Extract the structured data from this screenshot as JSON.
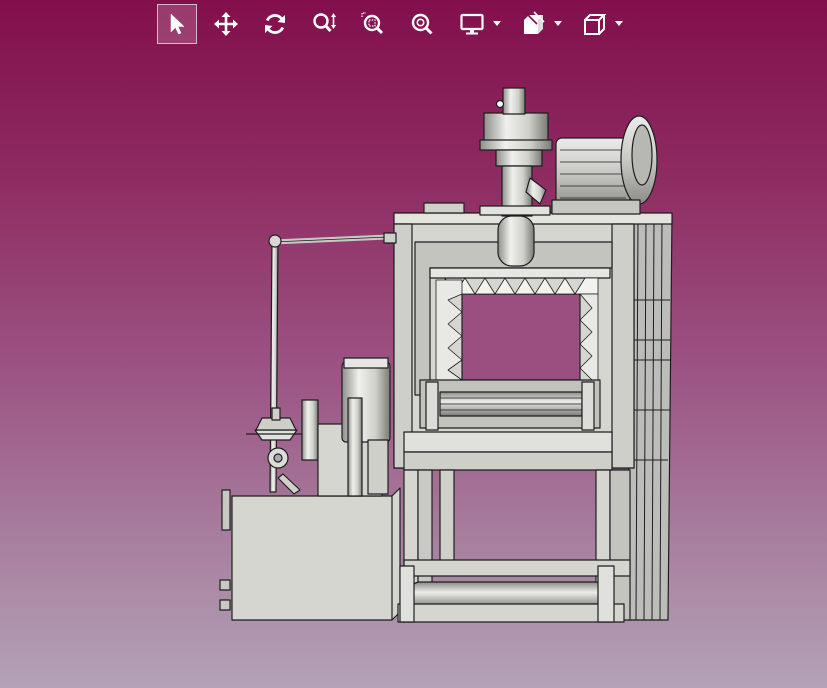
{
  "toolbar": {
    "tools": [
      {
        "name": "select",
        "icon": "arrow-cursor-icon",
        "active": true
      },
      {
        "name": "pan",
        "icon": "move-arrows-icon"
      },
      {
        "name": "rotate",
        "icon": "rotate-icon"
      },
      {
        "name": "zoom",
        "icon": "zoom-vertical-icon"
      },
      {
        "name": "zoom-window",
        "icon": "zoom-window-icon"
      },
      {
        "name": "zoom-fit",
        "icon": "zoom-fit-icon"
      },
      {
        "name": "display-mode",
        "icon": "monitor-icon",
        "has_dropdown": true
      },
      {
        "name": "section-view",
        "icon": "section-box-icon",
        "has_dropdown": true
      },
      {
        "name": "view-orientation",
        "icon": "cube-icon",
        "has_dropdown": true
      }
    ]
  },
  "viewport": {
    "background_top": "#820f4c",
    "background_bottom": "#b3a2b6",
    "model_color": "#d6d6d1",
    "edge_color": "#1e1e1e"
  }
}
